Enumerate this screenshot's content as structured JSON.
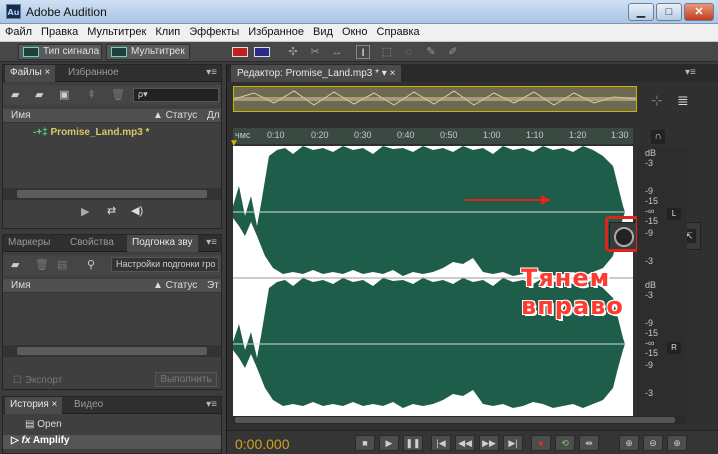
{
  "window": {
    "title": "Adobe Audition",
    "icon": "Au"
  },
  "menu": [
    "Файл",
    "Правка",
    "Мультитрек",
    "Клип",
    "Эффекты",
    "Избранное",
    "Вид",
    "Окно",
    "Справка"
  ],
  "toolbar": {
    "waveform_label": "Тип сигнала",
    "multitrack_label": "Мультитрек"
  },
  "files_panel": {
    "tabs": [
      "Файлы ×",
      "Избранное"
    ],
    "search_placeholder": "",
    "col_name": "Имя",
    "col_status": "▲ Статус",
    "col_extra": "Дл",
    "file": "Promise_Land.mp3 *"
  },
  "match_panel": {
    "tabs": [
      "Маркеры",
      "Свойства",
      "Подгонка зву"
    ],
    "settings_label": "Настройки подгонки гро",
    "col_name": "Имя",
    "col_status": "▲ Статус",
    "col_extra": "Эт",
    "export_label": "Экспорт",
    "run_label": "Выполнить"
  },
  "history_panel": {
    "tabs": [
      "История ×",
      "Видео"
    ],
    "items": [
      "Open",
      "Amplify"
    ]
  },
  "editor": {
    "tab_label": "Редактор: Promise_Land.mp3 *",
    "ruler_ticks": [
      "чмс",
      "0:10",
      "0:20",
      "0:30",
      "0:40",
      "0:50",
      "1:00",
      "1:10",
      "1:20",
      "1:30"
    ],
    "db_scale_top": [
      "dB",
      "-3",
      "-9",
      "-15",
      "-∞",
      "-15",
      "-9",
      "-3"
    ],
    "db_scale_bottom": [
      "dB",
      "-3",
      "-9",
      "-15",
      "-∞",
      "-15",
      "-9",
      "-3"
    ],
    "channel_left": "L",
    "channel_right": "R",
    "hud_unit": "dB",
    "annotation": "Тянем вправо",
    "timecode": "0:00.000"
  },
  "colors": {
    "waveform": "#1f5d4b",
    "annotation": "#ff3b2f",
    "timecode": "#d4a020",
    "highlight": "#e0241a"
  }
}
